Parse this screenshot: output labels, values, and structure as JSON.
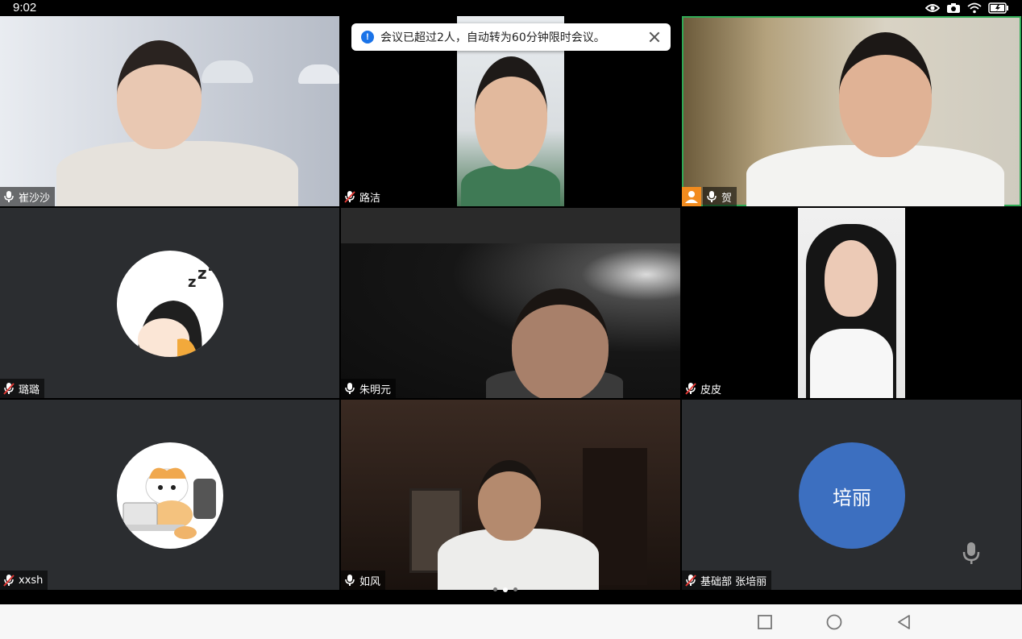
{
  "status_bar": {
    "time": "9:02"
  },
  "toast": {
    "message": "会议已超过2人，自动转为60分钟限时会议。"
  },
  "participants": [
    {
      "name": "崔沙沙",
      "muted": false
    },
    {
      "name": "路洁",
      "muted": true
    },
    {
      "name": "贺",
      "muted": false,
      "host": true
    },
    {
      "name": "璐璐",
      "muted": true
    },
    {
      "name": "朱明元",
      "muted": false
    },
    {
      "name": "皮皮",
      "muted": true
    },
    {
      "name": "xxsh",
      "muted": true
    },
    {
      "name": "如风",
      "muted": false
    },
    {
      "name": "基础部 张培丽",
      "muted": true
    }
  ],
  "avatar_initials": "培丽",
  "pager": {
    "pages": 3,
    "current": 2
  },
  "colors": {
    "accent_active": "#2faa55",
    "host_badge": "#f28b1e",
    "initials_bg": "#3c6fc0",
    "toast_info": "#1a73e8"
  },
  "icons": [
    "eye-icon",
    "camera-icon",
    "wifi-icon",
    "battery-icon",
    "mic-icon",
    "mic-off-icon",
    "close-icon",
    "info-icon",
    "person-icon",
    "square-icon",
    "circle-icon",
    "back-triangle-icon"
  ]
}
